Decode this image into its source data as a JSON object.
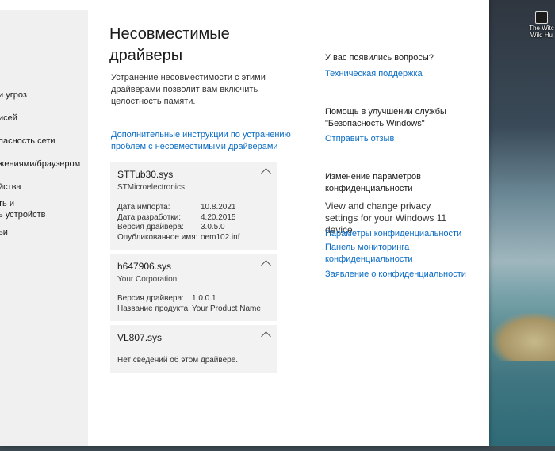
{
  "desktop": {
    "icon_label": "The Witc Wild Hu"
  },
  "sidebar": {
    "items": [
      {
        "label": "и угроз"
      },
      {
        "label": "исей"
      },
      {
        "label": "пасность сети"
      },
      {
        "label": "жениями/браузером"
      },
      {
        "label": "йства"
      },
      {
        "label": "ть и"
      },
      {
        "label": "ь устройств"
      },
      {
        "label": "ьи"
      }
    ]
  },
  "window": {
    "minimize": "—",
    "maximize": "☐",
    "close": "✕"
  },
  "page": {
    "title_line1": "Несовместимые",
    "title_line2": "драйверы",
    "description": "Устранение несовместимости с этими драйверами позволит вам включить целостность памяти.",
    "more_link": "Дополнительные инструкции по устранению проблем с несовместимыми драйверами"
  },
  "drivers": [
    {
      "name": "STTub30.sys",
      "vendor": "STMicroelectronics",
      "fields": [
        {
          "key": "Дата импорта:",
          "value": "10.8.2021"
        },
        {
          "key": "Дата разработки:",
          "value": "4.20.2015"
        },
        {
          "key": "Версия драйвера:",
          "value": "3.0.5.0"
        },
        {
          "key": "Опубликованное имя:",
          "value": "oem102.inf"
        }
      ]
    },
    {
      "name": "h647906.sys",
      "vendor": "Your Corporation",
      "fields": [
        {
          "key": "Версия драйвера:",
          "value": "1.0.0.1"
        },
        {
          "key": "Название продукта:",
          "value": "Your Product Name"
        }
      ]
    },
    {
      "name": "VL807.sys",
      "vendor": "",
      "note": "Нет сведений об этом драйвере."
    }
  ],
  "help": {
    "questions_head": "У вас появились вопросы?",
    "support_link": "Техническая поддержка",
    "improve_head": "Помощь в улучшении службы \"Безопасность Windows\"",
    "feedback_link": "Отправить отзыв",
    "privacy_head": "Изменение параметров конфиденциальности",
    "privacy_text": "View and change privacy settings for your Windows 11 device.",
    "privacy_settings_link": "Параметры конфиденциальности",
    "privacy_dashboard_link": "Панель мониторинга конфиденциальности",
    "privacy_statement_link": "Заявление о конфиденциальности"
  }
}
